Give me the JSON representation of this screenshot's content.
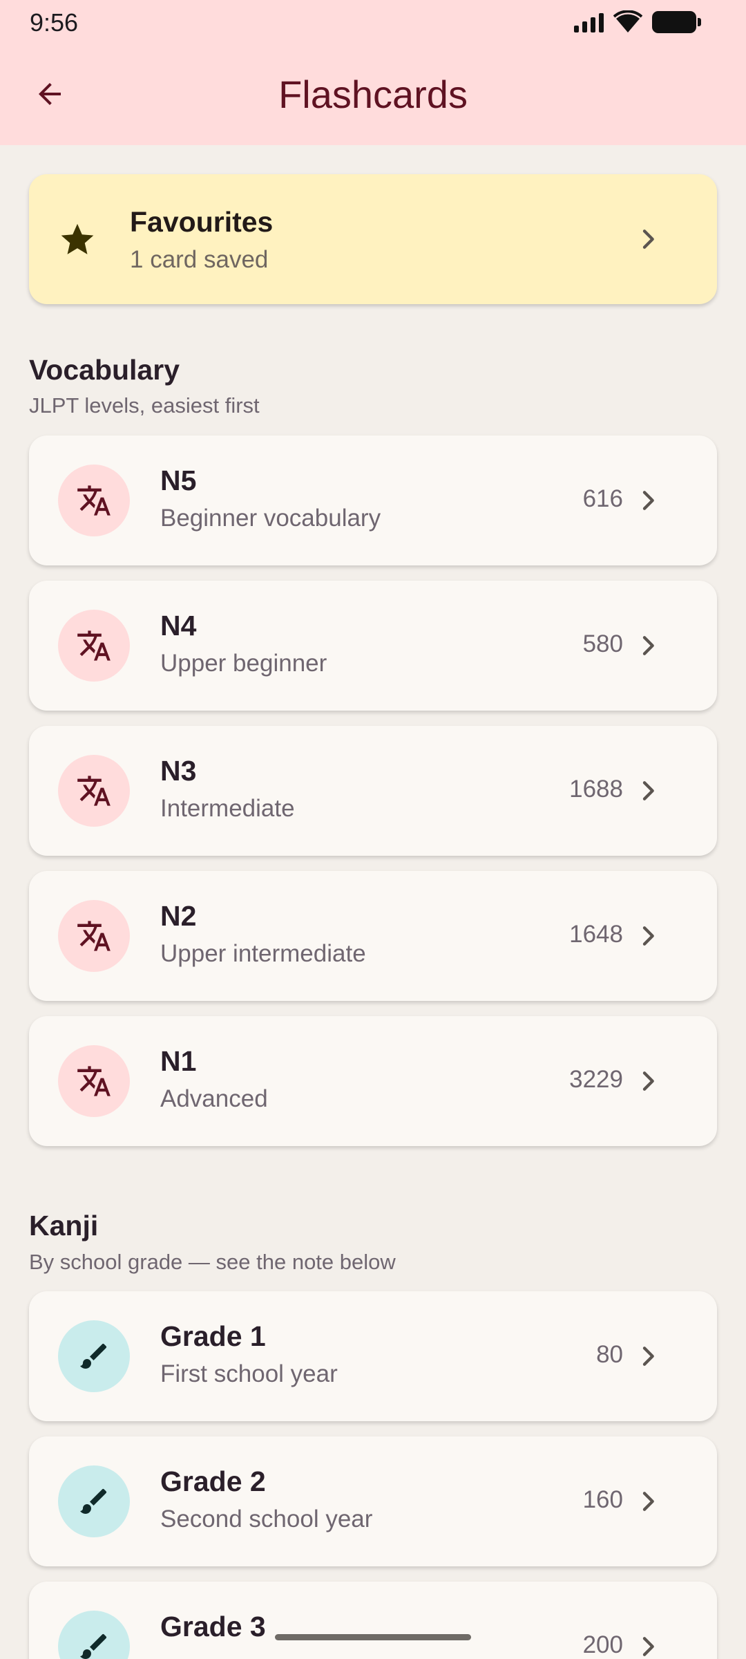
{
  "status_bar": {
    "time": "9:56"
  },
  "app_bar": {
    "title": "Flashcards"
  },
  "favourites": {
    "title": "Favourites",
    "subtitle": "1 card saved"
  },
  "vocabulary": {
    "title": "Vocabulary",
    "subtitle": "JLPT levels, easiest first",
    "items": [
      {
        "title": "N5",
        "subtitle": "Beginner vocabulary",
        "count": "616"
      },
      {
        "title": "N4",
        "subtitle": "Upper beginner",
        "count": "580"
      },
      {
        "title": "N3",
        "subtitle": "Intermediate",
        "count": "1688"
      },
      {
        "title": "N2",
        "subtitle": "Upper intermediate",
        "count": "1648"
      },
      {
        "title": "N1",
        "subtitle": "Advanced",
        "count": "3229"
      }
    ]
  },
  "kanji": {
    "title": "Kanji",
    "subtitle": "By school grade — see the note below",
    "items": [
      {
        "title": "Grade 1",
        "subtitle": "First school year",
        "count": "80"
      },
      {
        "title": "Grade 2",
        "subtitle": "Second school year",
        "count": "160"
      },
      {
        "title": "Grade 3",
        "subtitle": "",
        "count": "200"
      }
    ]
  },
  "colors": {
    "app_bar_bg": "#ffdcdc",
    "title": "#5f1222",
    "favourites_bg": "#fff2c0",
    "vocab_avatar_bg": "#ffdcdc",
    "kanji_avatar_bg": "#c9ecec",
    "page_bg": "#f3efea"
  },
  "icons": {
    "back": "arrow-back-icon",
    "favourites": "star-icon",
    "vocabulary": "translate-icon",
    "kanji": "brush-icon",
    "row": "chevron-right-icon"
  }
}
